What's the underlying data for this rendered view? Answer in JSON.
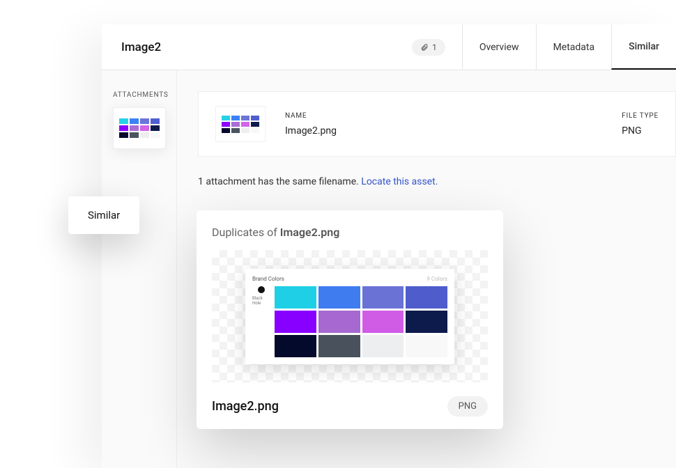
{
  "header": {
    "title": "Image2",
    "attachments_count": "1",
    "tabs": {
      "overview": "Overview",
      "metadata": "Metadata",
      "similar": "Similar"
    }
  },
  "sidebar": {
    "attachments_label": "ATTACHMENTS"
  },
  "info": {
    "name_label": "NAME",
    "name_value": "Image2.png",
    "filetype_label": "FILE TYPE",
    "filetype_value": "PNG"
  },
  "message": {
    "text": "1 attachment has the same filename. ",
    "link": "Locate this asset."
  },
  "float_chip": "Similar",
  "duplicates": {
    "prefix": "Duplicates of ",
    "filename": "Image2.png",
    "palette_title": "Brand Colors",
    "palette_count": "9 Colors",
    "footer_filename": "Image2.png",
    "footer_badge": "PNG"
  }
}
